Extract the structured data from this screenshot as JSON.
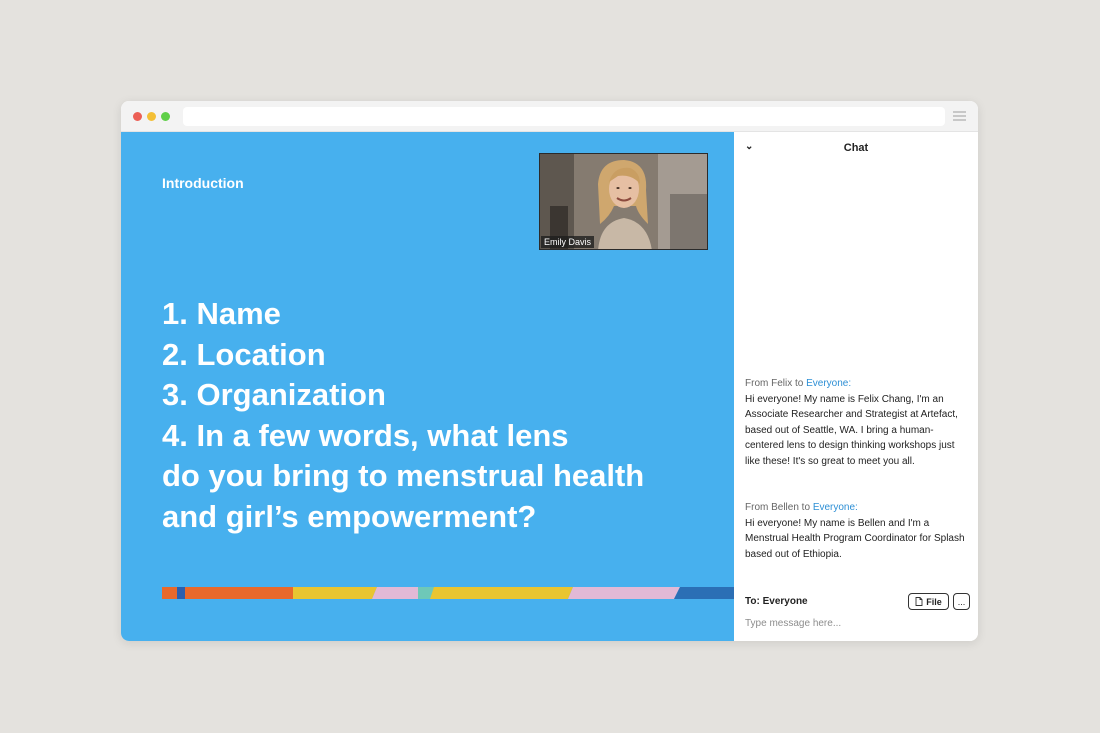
{
  "window": {
    "url": ""
  },
  "slide": {
    "label": "Introduction",
    "questions": [
      "1. Name",
      "2. Location",
      "3. Organization",
      "4. In a few words, what lens",
      "do you bring to menstrual health",
      "and girl’s empowerment?"
    ],
    "background_color": "#47b0ee",
    "color_strip": [
      "#e8692b",
      "#2b5fae",
      "#e8692b",
      "#e9c531",
      "#e2b9d6",
      "#6ec8b8",
      "#e9c531",
      "#e2b9d6",
      "#2b6fb5"
    ]
  },
  "video": {
    "participant_name": "Emily Davis"
  },
  "chat": {
    "collapse_icon": "chevron-down-icon",
    "title": "Chat",
    "messages": [
      {
        "from_prefix": "From Felix to ",
        "recipient": "Everyone:",
        "text": "Hi everyone! My name is Felix Chang, I'm an Associate Researcher and Strategist at Artefact, based out of Seattle, WA. I bring a human-centered lens to design thinking workshops just like these! It's so great to meet you all."
      },
      {
        "from_prefix": "From Bellen to ",
        "recipient": "Everyone:",
        "text": "Hi everyone! My name is Bellen and I'm a Menstrual Health Program Coordinator for Splash based out of Ethiopia."
      }
    ],
    "to_label": "To: Everyone",
    "file_button_label": "File",
    "more_button_label": "...",
    "input_placeholder": "Type message here...",
    "recipient_color": "#2d8fd5"
  }
}
